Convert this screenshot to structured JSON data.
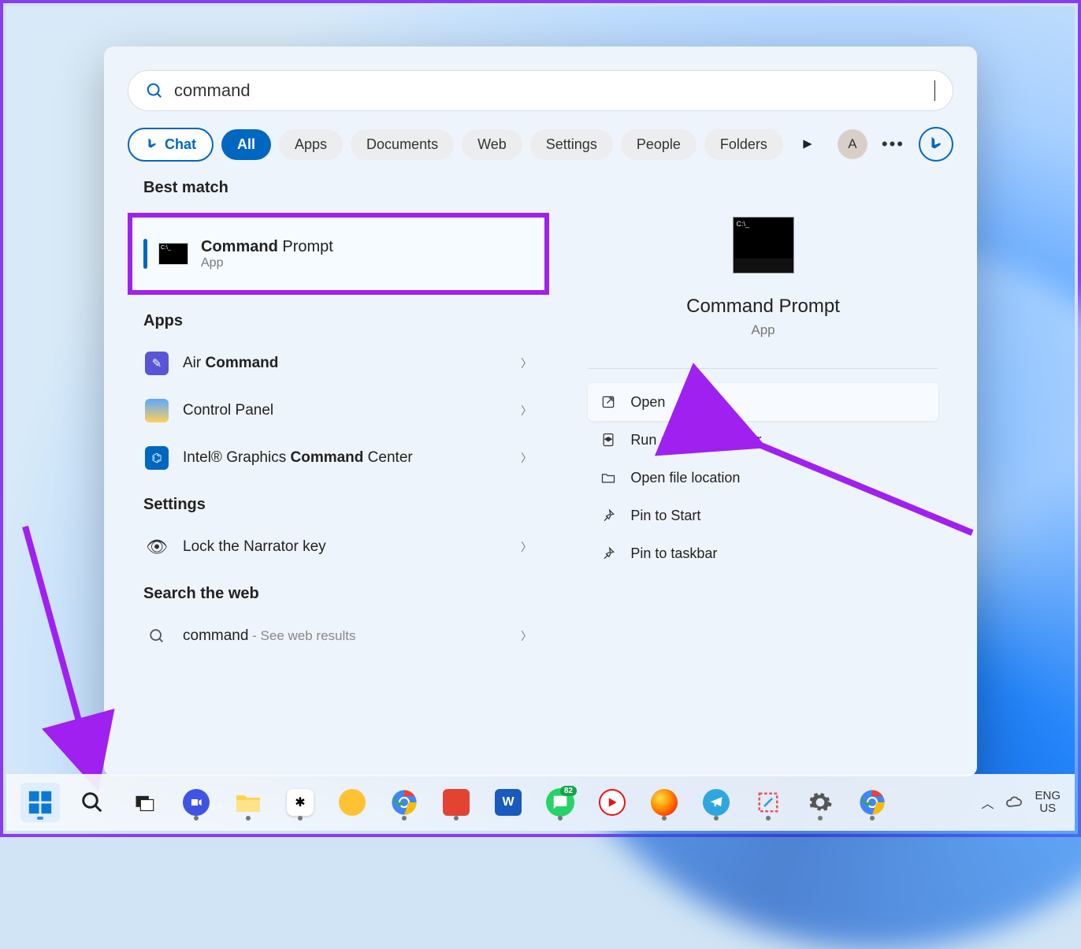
{
  "search": {
    "value": "command"
  },
  "filters": {
    "chat": "Chat",
    "items": [
      "All",
      "Apps",
      "Documents",
      "Web",
      "Settings",
      "People",
      "Folders"
    ],
    "active": "All"
  },
  "user_initial": "A",
  "left": {
    "best_match_heading": "Best match",
    "best_match": {
      "titlebold": "Command",
      "titlerest": " Prompt",
      "sub": "App"
    },
    "apps_heading": "Apps",
    "apps": [
      {
        "prefix": "Air ",
        "bold": "Command",
        "suffix": ""
      },
      {
        "prefix": "Control Panel",
        "bold": "",
        "suffix": ""
      },
      {
        "prefix": "Intel® Graphics ",
        "bold": "Command",
        "suffix": " Center"
      }
    ],
    "settings_heading": "Settings",
    "settings": [
      {
        "label": "Lock the Narrator key"
      }
    ],
    "web_heading": "Search the web",
    "web": {
      "query": "command",
      "hint": " - See web results"
    }
  },
  "detail": {
    "title": "Command Prompt",
    "sub": "App",
    "actions": [
      "Open",
      "Run as administrator",
      "Open file location",
      "Pin to Start",
      "Pin to taskbar"
    ]
  },
  "taskbar": {
    "language": "ENG",
    "locale": "US"
  }
}
